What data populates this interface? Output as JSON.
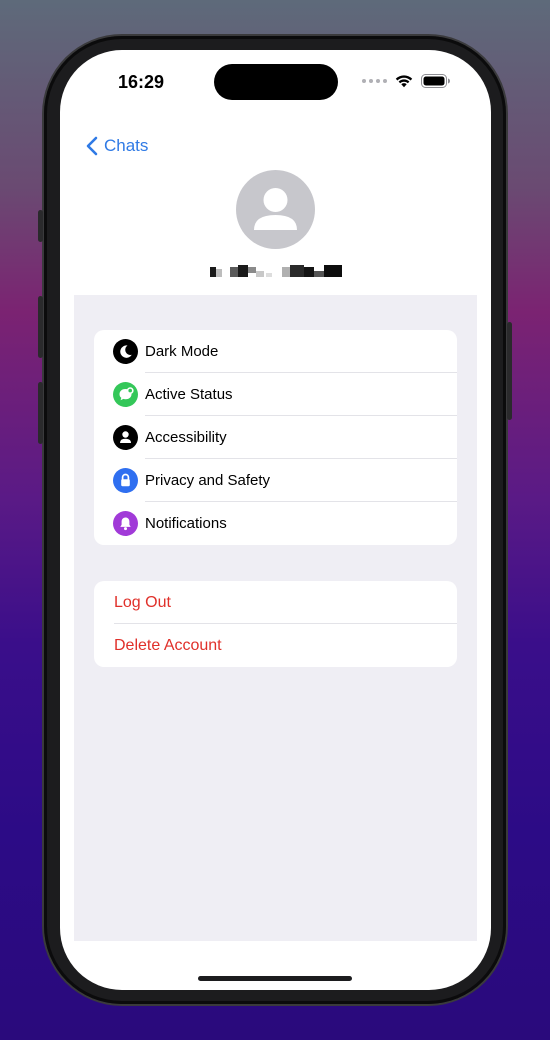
{
  "status_bar": {
    "time": "16:29"
  },
  "nav": {
    "back_label": "Chats"
  },
  "settings": {
    "items": [
      {
        "label": "Dark Mode",
        "icon": "moon-icon",
        "color": "#000000"
      },
      {
        "label": "Active Status",
        "icon": "chat-bubble-icon",
        "color": "#34c759"
      },
      {
        "label": "Accessibility",
        "icon": "person-icon",
        "color": "#000000"
      },
      {
        "label": "Privacy and Safety",
        "icon": "lock-icon",
        "color": "#2f6ff0"
      },
      {
        "label": "Notifications",
        "icon": "bell-icon",
        "color": "#a13ad8"
      }
    ]
  },
  "account": {
    "log_out": "Log Out",
    "delete_account": "Delete Account",
    "color": "#e0302a"
  },
  "colors": {
    "accent": "#2f7ae5",
    "grouped_background": "#efeef4"
  }
}
